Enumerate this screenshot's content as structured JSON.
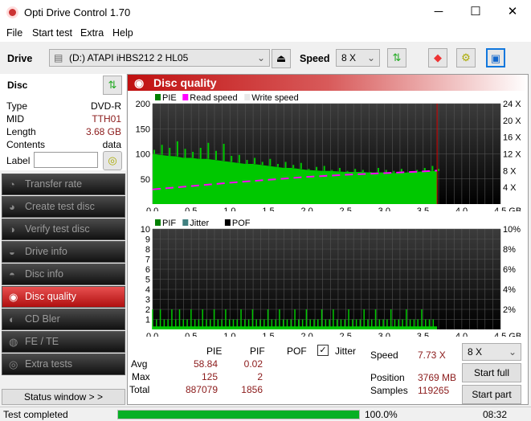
{
  "window": {
    "title": "Opti Drive Control 1.70",
    "minimize": "─",
    "maximize": "☐",
    "close": "✕"
  },
  "menu": [
    "File",
    "Start test",
    "Extra",
    "Help"
  ],
  "toolbar": {
    "drive_label": "Drive",
    "drive_value": "(D:)   ATAPI iHBS212   2 HL05",
    "speed_label": "Speed",
    "speed_value": "8 X"
  },
  "disc": {
    "title": "Disc",
    "type_label": "Type",
    "type": "DVD-R",
    "mid_label": "MID",
    "mid": "TTH01",
    "length_label": "Length",
    "length": "3.68 GB",
    "contents_label": "Contents",
    "contents": "data",
    "label_label": "Label",
    "label_value": ""
  },
  "nav": [
    "Transfer rate",
    "Create test disc",
    "Verify test disc",
    "Drive info",
    "Disc info",
    "Disc quality",
    "CD Bler",
    "FE / TE",
    "Extra tests"
  ],
  "status_window": "Status window > >",
  "panel_title": "Disc quality",
  "chart_data": [
    {
      "type": "bar",
      "title": "PIE / Read speed",
      "legend": [
        "PIE",
        "Read speed",
        "Write speed"
      ],
      "legend_colors": [
        "#008000",
        "#ff00ff",
        "#e8e8e8"
      ],
      "x_ticks": [
        "0.0",
        "0.5",
        "1.0",
        "1.5",
        "2.0",
        "2.5",
        "3.0",
        "3.5",
        "4.0",
        "4.5 GB"
      ],
      "xlim": [
        0,
        4.5
      ],
      "y_ticks": [
        "200",
        "150",
        "100",
        "50"
      ],
      "ylim": [
        0,
        200
      ],
      "y2_ticks": [
        "24 X",
        "20 X",
        "16 X",
        "12 X",
        "8 X",
        "4 X"
      ],
      "y2lim": [
        0,
        24
      ],
      "x": [
        0,
        0.1,
        0.2,
        0.3,
        0.4,
        0.5,
        0.6,
        0.7,
        0.8,
        0.9,
        1.0,
        1.1,
        1.2,
        1.3,
        1.4,
        1.5,
        1.6,
        1.7,
        1.8,
        1.9,
        2.0,
        2.1,
        2.2,
        2.3,
        2.4,
        2.5,
        2.6,
        2.7,
        2.8,
        2.9,
        3.0,
        3.1,
        3.2,
        3.3,
        3.4,
        3.5,
        3.6,
        3.68
      ],
      "pie": [
        108,
        118,
        112,
        125,
        110,
        104,
        112,
        122,
        106,
        120,
        96,
        98,
        88,
        92,
        84,
        90,
        80,
        84,
        78,
        82,
        70,
        74,
        76,
        68,
        72,
        66,
        70,
        68,
        64,
        72,
        68,
        66,
        70,
        64,
        68,
        72,
        76,
        70
      ],
      "pie_base": [
        100,
        98,
        96,
        95,
        92,
        92,
        90,
        90,
        88,
        86,
        84,
        82,
        80,
        80,
        78,
        76,
        74,
        72,
        72,
        70,
        68,
        67,
        66,
        66,
        65,
        64,
        64,
        64,
        63,
        63,
        63,
        62,
        62,
        63,
        64,
        65,
        66,
        66
      ],
      "read_speed_x": [
        0,
        0.5,
        1.0,
        1.5,
        2.0,
        2.5,
        3.0,
        3.5,
        3.68
      ],
      "read_speed": [
        3.5,
        4.3,
        5.1,
        5.8,
        6.5,
        7.0,
        7.4,
        7.8,
        8.0
      ]
    },
    {
      "type": "bar",
      "title": "PIF / Jitter / POF",
      "legend": [
        "PIF",
        "Jitter",
        "POF"
      ],
      "legend_colors": [
        "#008000",
        "#408080",
        "#000000"
      ],
      "x_ticks": [
        "0.0",
        "0.5",
        "1.0",
        "1.5",
        "2.0",
        "2.5",
        "3.0",
        "3.5",
        "4.0",
        "4.5 GB"
      ],
      "xlim": [
        0,
        4.5
      ],
      "y_ticks": [
        "10",
        "9",
        "8",
        "7",
        "6",
        "5",
        "4",
        "3",
        "2",
        "1"
      ],
      "ylim": [
        0,
        10
      ],
      "y2_ticks": [
        "10%",
        "8%",
        "6%",
        "4%",
        "2%"
      ],
      "y2lim": [
        0,
        10
      ],
      "pif": [
        2,
        1,
        2,
        1,
        1,
        2,
        1,
        2,
        1,
        1,
        2,
        1,
        1,
        2,
        1,
        1,
        2,
        1,
        1,
        2,
        1,
        1,
        1,
        2,
        1,
        1,
        2,
        1,
        1,
        1,
        2,
        1,
        1,
        2,
        1,
        1,
        1,
        2,
        1,
        1,
        2,
        1,
        1,
        1,
        2,
        1,
        1,
        2,
        1,
        1,
        1,
        2,
        1,
        1,
        1,
        2,
        1,
        1,
        2,
        1,
        1,
        1,
        2,
        1,
        1,
        1,
        2,
        1,
        1,
        1,
        2,
        1,
        1,
        1
      ]
    }
  ],
  "stats": {
    "col_pie": "PIE",
    "col_pif": "PIF",
    "col_pof": "POF",
    "jitter_label": "Jitter",
    "jitter_checked": true,
    "avg_label": "Avg",
    "max_label": "Max",
    "total_label": "Total",
    "pie_avg": "58.84",
    "pif_avg": "0.02",
    "pie_max": "125",
    "pif_max": "2",
    "pie_total": "887079",
    "pif_total": "1856",
    "speed_label": "Speed",
    "speed": "7.73 X",
    "position_label": "Position",
    "position": "3769 MB",
    "samples_label": "Samples",
    "samples": "119265",
    "speed_select": "8 X",
    "start_full": "Start full",
    "start_part": "Start part"
  },
  "statusbar": {
    "text": "Test completed",
    "progress": 100.0,
    "progress_text": "100.0%",
    "time": "08:32"
  }
}
